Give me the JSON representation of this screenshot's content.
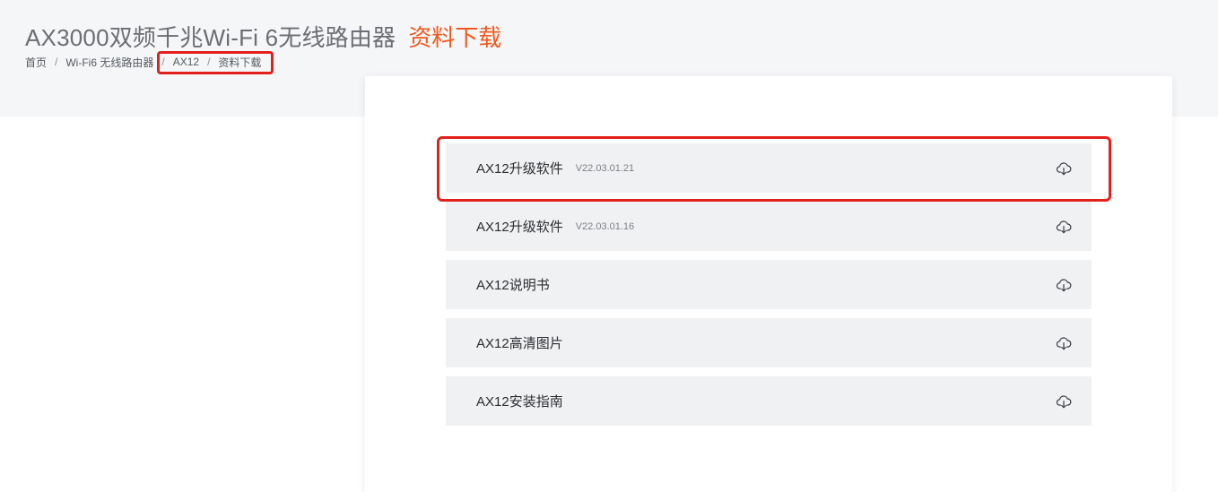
{
  "header": {
    "product_name": "AX3000双频千兆Wi-Fi 6无线路由器",
    "section_name": "资料下载"
  },
  "breadcrumb": {
    "items": [
      "首页",
      "Wi-Fi6 无线路由器",
      "AX12",
      "资料下载"
    ],
    "separator": "/"
  },
  "downloads": [
    {
      "name": "AX12升级软件",
      "version": "V22.03.01.21",
      "icon": "cloud-download-icon"
    },
    {
      "name": "AX12升级软件",
      "version": "V22.03.01.16",
      "icon": "cloud-download-icon"
    },
    {
      "name": "AX12说明书",
      "version": "",
      "icon": "cloud-download-icon"
    },
    {
      "name": "AX12高清图片",
      "version": "",
      "icon": "cloud-download-icon"
    },
    {
      "name": "AX12安装指南",
      "version": "",
      "icon": "cloud-download-icon"
    }
  ],
  "colors": {
    "accent": "#f2581e",
    "highlight_box": "#e3201b",
    "row_background": "#f0f1f3",
    "header_background": "#f5f6f7"
  }
}
